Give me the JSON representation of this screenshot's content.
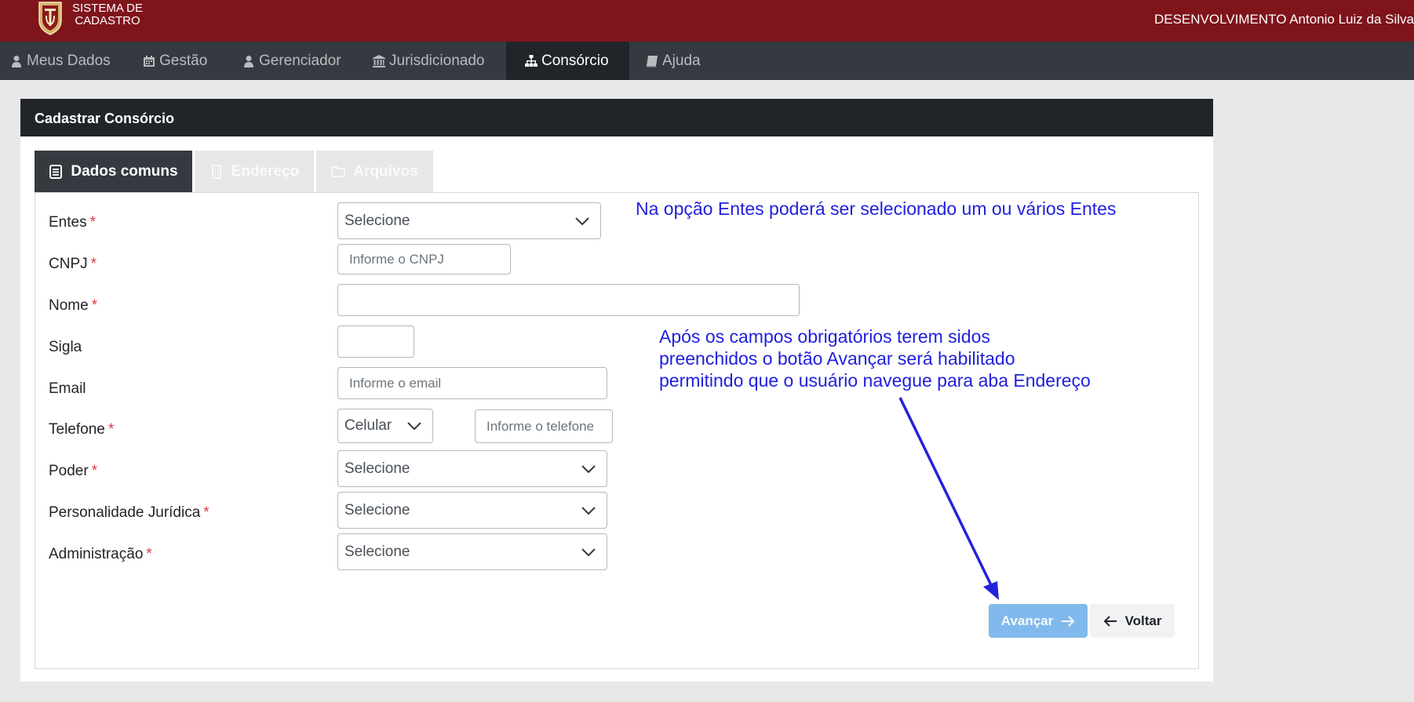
{
  "header": {
    "system_line1": "SISTEMA DE",
    "system_line2": "CADASTRO",
    "user_env": "DESENVOLVIMENTO Antonio Luiz da Silva"
  },
  "nav": {
    "items": [
      {
        "label": "Meus Dados",
        "icon": "user-icon"
      },
      {
        "label": "Gestão",
        "icon": "calendar-icon"
      },
      {
        "label": "Gerenciador",
        "icon": "user-icon"
      },
      {
        "label": "Jurisdicionado",
        "icon": "bank-icon"
      },
      {
        "label": "Consórcio",
        "icon": "sitemap-icon",
        "active": true
      },
      {
        "label": "Ajuda",
        "icon": "book-icon"
      }
    ]
  },
  "card": {
    "title": "Cadastrar Consórcio"
  },
  "tabs": [
    {
      "label": "Dados comuns",
      "icon": "document-icon",
      "active": true
    },
    {
      "label": "Endereço",
      "icon": "building-icon",
      "active": false
    },
    {
      "label": "Arquivos",
      "icon": "folder-icon",
      "active": false
    }
  ],
  "form": {
    "entes": {
      "label": "Entes",
      "required": "*",
      "value": "Selecione"
    },
    "cnpj": {
      "label": "CNPJ",
      "required": "*",
      "placeholder": "Informe o CNPJ"
    },
    "nome": {
      "label": "Nome",
      "required": "*",
      "value": ""
    },
    "sigla": {
      "label": "Sigla",
      "value": ""
    },
    "email": {
      "label": "Email",
      "placeholder": "Informe o email"
    },
    "telefone": {
      "label": "Telefone",
      "required": "*",
      "type_value": "Celular",
      "placeholder": "Informe o telefone"
    },
    "poder": {
      "label": "Poder",
      "required": "*",
      "value": "Selecione"
    },
    "personalidade": {
      "label": "Personalidade Jurídica",
      "required": "*",
      "value": "Selecione"
    },
    "administracao": {
      "label": "Administração",
      "required": "*",
      "value": "Selecione"
    }
  },
  "annotations": {
    "note1": "Na opção Entes poderá ser selecionado um ou vários Entes",
    "note2_line1": "Após os campos obrigatórios terem sidos",
    "note2_line2": "preenchidos o botão Avançar será habilitado",
    "note2_line3": "permitindo que o usuário navegue para aba Endereço"
  },
  "buttons": {
    "next": "Avançar",
    "back": "Voltar"
  },
  "colors": {
    "brand": "#7f141b",
    "nav": "#343a40",
    "annotation": "#2020dd",
    "next_disabled": "#82b9ec",
    "required": "#dc3545"
  }
}
